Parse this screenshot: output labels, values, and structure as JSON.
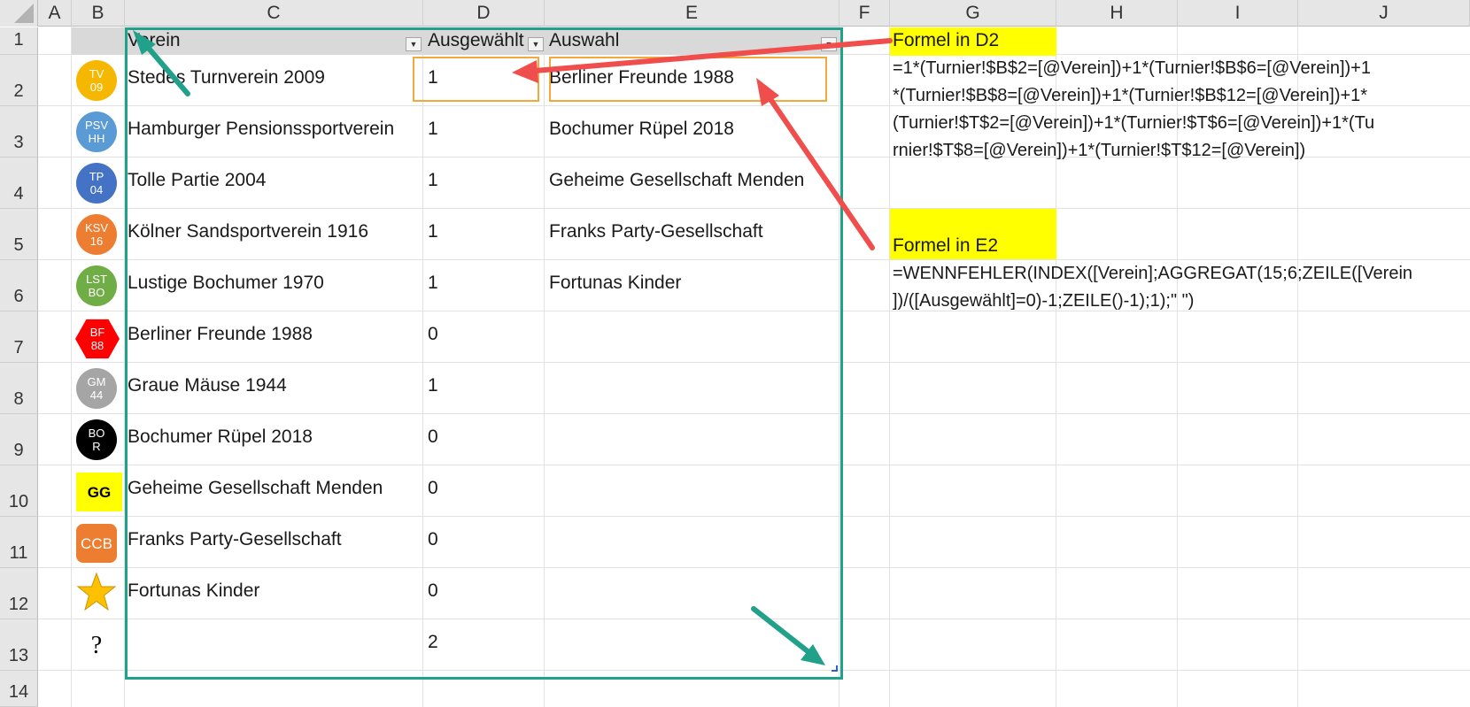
{
  "columns": [
    "A",
    "B",
    "C",
    "D",
    "E",
    "F",
    "G",
    "H",
    "I",
    "J"
  ],
  "rows": [
    "1",
    "2",
    "3",
    "4",
    "5",
    "6",
    "7",
    "8",
    "9",
    "10",
    "11",
    "12",
    "13",
    "14"
  ],
  "table": {
    "headers": {
      "verein": "Verein",
      "ausgewaehlt": "Ausgewählt",
      "auswahl": "Auswahl"
    },
    "verein": [
      "Stedes Turnverein 2009",
      "Hamburger Pensionssportverein",
      "Tolle Partie 2004",
      "Kölner Sandsportverein 1916",
      "Lustige Bochumer 1970",
      "Berliner Freunde 1988",
      "Graue Mäuse 1944",
      "Bochumer Rüpel 2018",
      "Geheime Gesellschaft Menden",
      "Franks Party-Gesellschaft",
      "Fortunas Kinder"
    ],
    "ausgewaehlt": [
      "1",
      "1",
      "1",
      "1",
      "1",
      "0",
      "1",
      "0",
      "0",
      "0",
      "0",
      "2"
    ],
    "auswahl": [
      "Berliner Freunde 1988",
      "Bochumer Rüpel 2018",
      "Geheime Gesellschaft Menden",
      "Franks Party-Gesellschaft",
      "Fortunas Kinder"
    ]
  },
  "logos": [
    {
      "l1": "TV",
      "l2": "09",
      "color": "#f5b700",
      "icon": "tv09-logo"
    },
    {
      "l1": "PSV",
      "l2": "HH",
      "color": "#5b9bd5",
      "icon": "psvhh-logo"
    },
    {
      "l1": "TP",
      "l2": "04",
      "color": "#4472c4",
      "icon": "tp04-logo"
    },
    {
      "l1": "KSV",
      "l2": "16",
      "color": "#ed7d31",
      "icon": "ksv16-logo"
    },
    {
      "l1": "LST",
      "l2": "BO",
      "color": "#70ad47",
      "icon": "lstbo-logo"
    },
    {
      "l1": "BF",
      "l2": "88",
      "color": "#ff0000",
      "icon": "bf88-logo"
    },
    {
      "l1": "GM",
      "l2": "44",
      "color": "#a5a5a5",
      "icon": "gm44-logo"
    },
    {
      "l1": "BO",
      "l2": "R",
      "color": "#000000",
      "icon": "bor-logo"
    },
    {
      "l1": "GG",
      "l2": "",
      "color": "#ffff00",
      "icon": "gg-logo"
    },
    {
      "l1": "CCB",
      "l2": "",
      "color": "#ed7d31",
      "icon": "ccb-logo"
    },
    {
      "l1": "",
      "l2": "",
      "color": "#ffc000",
      "icon": "star-icon"
    },
    {
      "l1": "?",
      "l2": "",
      "color": "#ffffff",
      "icon": "question-icon"
    }
  ],
  "notes": {
    "d2_label": "Formel in D2",
    "d2_formula": [
      "=1*(Turnier!$B$2=[@Verein])+1*(Turnier!$B$6=[@Verein])+1",
      "*(Turnier!$B$8=[@Verein])+1*(Turnier!$B$12=[@Verein])+1*",
      "(Turnier!$T$2=[@Verein])+1*(Turnier!$T$6=[@Verein])+1*(Tu",
      "rnier!$T$8=[@Verein])+1*(Turnier!$T$12=[@Verein])"
    ],
    "e2_label": "Formel in E2",
    "e2_formula": [
      "=WENNFEHLER(INDEX([Verein];AGGREGAT(15;6;ZEILE([Verein",
      "])/([Ausgewählt]=0)-1;ZEILE()-1);1);\" \")"
    ]
  },
  "colors": {
    "table_border": "#21a189",
    "highlight_box": "#f2a93b",
    "red_arrow": "#f04d4d",
    "green_arrow": "#21a189",
    "note_fill": "#ffff00"
  }
}
